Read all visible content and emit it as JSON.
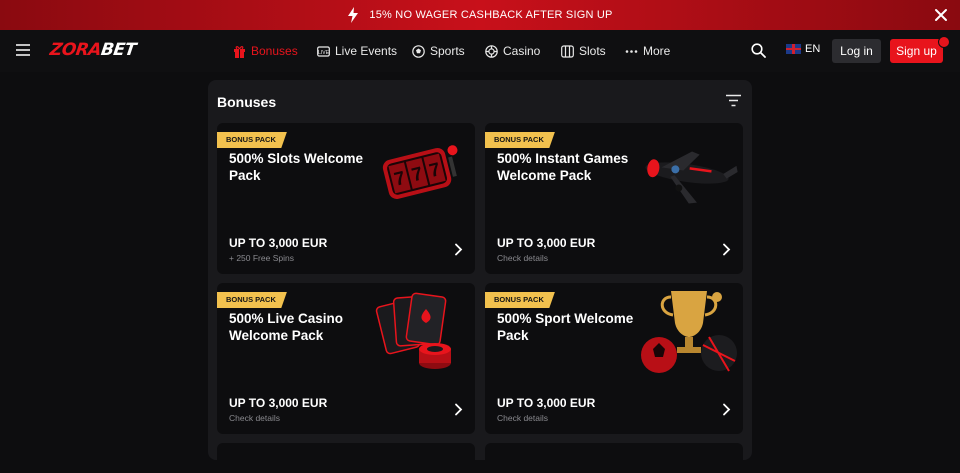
{
  "promo": {
    "text": "15% NO WAGER CASHBACK AFTER SIGN UP"
  },
  "logo": {
    "zora": "ZORA",
    "bet": "BET"
  },
  "nav": {
    "items": [
      {
        "label": "Bonuses",
        "icon": "gift-icon",
        "active": true
      },
      {
        "label": "Live Events",
        "icon": "live-tv-icon",
        "active": false
      },
      {
        "label": "Sports",
        "icon": "soccer-ball-icon",
        "active": false
      },
      {
        "label": "Casino",
        "icon": "poker-chip-icon",
        "active": false
      },
      {
        "label": "Slots",
        "icon": "slot-reels-icon",
        "active": false
      },
      {
        "label": "More",
        "icon": "dots-icon",
        "active": false
      }
    ],
    "lang": "EN",
    "login_label": "Log in",
    "signup_label": "Sign up"
  },
  "panel": {
    "title": "Bonuses"
  },
  "cards": [
    {
      "tag": "BONUS PACK",
      "title": "500% Slots Welcome Pack",
      "amount": "UP TO 3,000 EUR",
      "sub": "+ 250 Free Spins",
      "art": "slot-machine-reels"
    },
    {
      "tag": "BONUS PACK",
      "title": "500% Instant Games Welcome Pack",
      "amount": "UP TO 3,000 EUR",
      "sub": "Check details",
      "art": "airplane"
    },
    {
      "tag": "BONUS PACK",
      "title": "500% Live Casino Welcome Pack",
      "amount": "UP TO 3,000 EUR",
      "sub": "Check details",
      "art": "playing-cards-chips"
    },
    {
      "tag": "BONUS PACK",
      "title": "500% Sport Welcome Pack",
      "amount": "UP TO 3,000 EUR",
      "sub": "Check details",
      "art": "trophy-balls"
    }
  ],
  "colors": {
    "brand_red": "#e8141c",
    "tag_yellow": "#f2c14e",
    "panel_bg": "#19191c",
    "card_bg": "#0d0d0f"
  }
}
